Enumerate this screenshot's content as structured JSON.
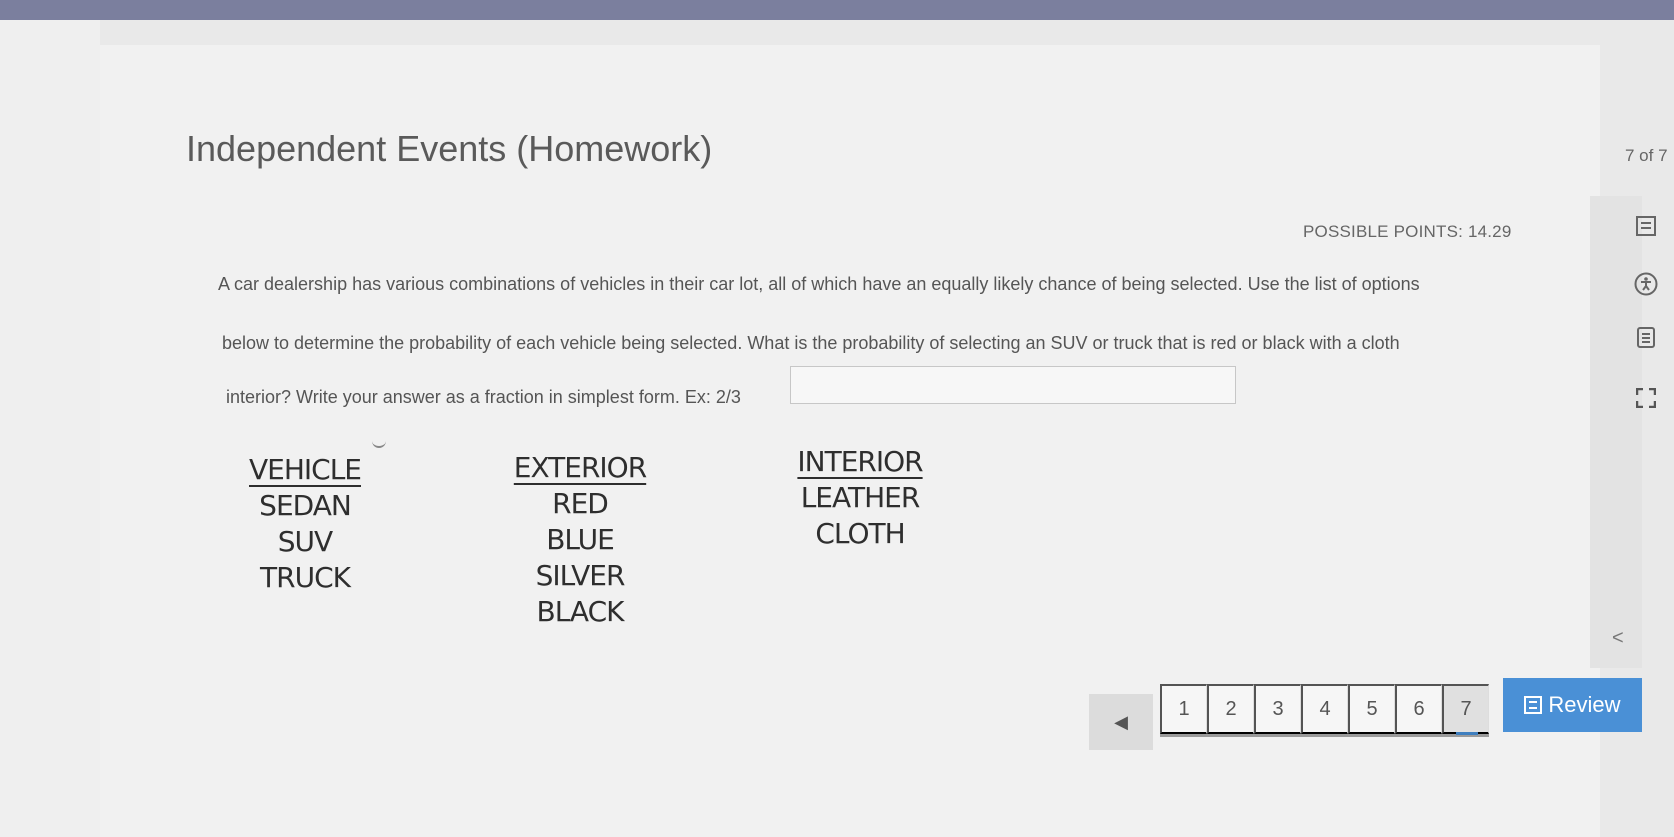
{
  "header": {
    "title": "Independent Events (Homework)",
    "counter": "7 of 7",
    "possible_points": "POSSIBLE POINTS: 14.29"
  },
  "question": {
    "line1": "A car dealership has various combinations of vehicles in their car lot, all of which have an equally likely chance of being selected.  Use the list of options",
    "line2": "below to determine the probability of each vehicle being selected.  What is the probability of selecting an SUV or truck that is red or black with a cloth",
    "line3": "interior? Write your answer as a fraction in simplest form. Ex: 2/3",
    "answer_value": ""
  },
  "lists": {
    "vehicle": {
      "header": "VEHICLE",
      "items": [
        "SEDAN",
        "SUV",
        "TRUCK"
      ]
    },
    "exterior": {
      "header": "EXTERIOR",
      "items": [
        "RED",
        "BLUE",
        "SILVER",
        "BLACK"
      ]
    },
    "interior": {
      "header": "INTERIOR",
      "items": [
        "LEATHER",
        "CLOTH"
      ]
    }
  },
  "side_tools": [
    "list-icon",
    "accessibility-icon",
    "notepad-icon",
    "fullscreen-icon"
  ],
  "collapse_glyph": "<",
  "pagination": {
    "prev_glyph": "◀",
    "pages": [
      "1",
      "2",
      "3",
      "4",
      "5",
      "6",
      "7"
    ],
    "current": "7",
    "review_label": "Review"
  }
}
